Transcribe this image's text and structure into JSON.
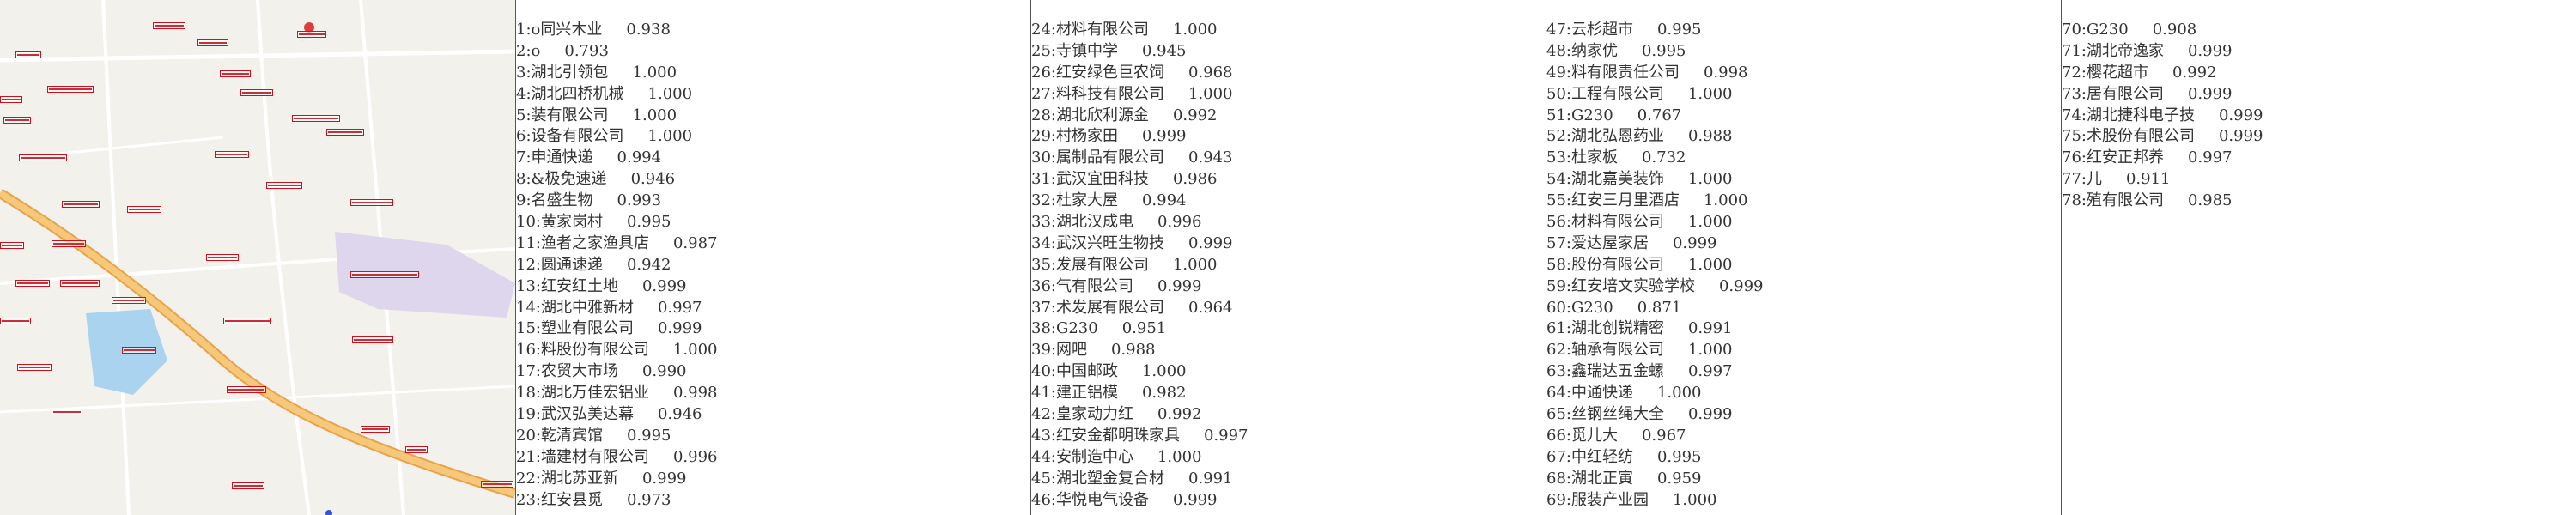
{
  "results": [
    {
      "n": "1:",
      "text": "o同兴木业",
      "score": "0.938"
    },
    {
      "n": "2:",
      "text": "o",
      "score": "0.793"
    },
    {
      "n": "3:",
      "text": "湖北引领包",
      "score": "1.000"
    },
    {
      "n": "4:",
      "text": "湖北四桥机械",
      "score": "1.000"
    },
    {
      "n": "5:",
      "text": "装有限公司",
      "score": "1.000"
    },
    {
      "n": "6:",
      "text": "设备有限公司",
      "score": "1.000"
    },
    {
      "n": "7:",
      "text": "申通快递",
      "score": "0.994"
    },
    {
      "n": "8:",
      "text": "&极免速递",
      "score": "0.946"
    },
    {
      "n": "9:",
      "text": "名盛生物",
      "score": "0.993"
    },
    {
      "n": "10:",
      "text": "黄家岗村",
      "score": "0.995"
    },
    {
      "n": "11:",
      "text": "渔者之家渔具店",
      "score": "0.987"
    },
    {
      "n": "12:",
      "text": "圆通速递",
      "score": "0.942"
    },
    {
      "n": "13:",
      "text": "红安红土地",
      "score": "0.999"
    },
    {
      "n": "14:",
      "text": "湖北中雅新材",
      "score": "0.997"
    },
    {
      "n": "15:",
      "text": "塑业有限公司",
      "score": "0.999"
    },
    {
      "n": "16:",
      "text": "料股份有限公司",
      "score": "1.000"
    },
    {
      "n": "17:",
      "text": "农贸大市场",
      "score": "0.990"
    },
    {
      "n": "18:",
      "text": "湖北万佳宏铝业",
      "score": "0.998"
    },
    {
      "n": "19:",
      "text": "武汉弘美达幕",
      "score": "0.946"
    },
    {
      "n": "20:",
      "text": "乾清宾馆",
      "score": "0.995"
    },
    {
      "n": "21:",
      "text": "墙建材有限公司",
      "score": "0.996"
    },
    {
      "n": "22:",
      "text": "湖北苏亚新",
      "score": "0.999"
    },
    {
      "n": "23:",
      "text": "红安县觅",
      "score": "0.973"
    },
    {
      "n": "24:",
      "text": "材料有限公司",
      "score": "1.000"
    },
    {
      "n": "25:",
      "text": "寺镇中学",
      "score": "0.945"
    },
    {
      "n": "26:",
      "text": "红安绿色巨农饲",
      "score": "0.968"
    },
    {
      "n": "27:",
      "text": "料科技有限公司",
      "score": "1.000"
    },
    {
      "n": "28:",
      "text": "湖北欣利源金",
      "score": "0.992"
    },
    {
      "n": "29:",
      "text": "村杨家田",
      "score": "0.999"
    },
    {
      "n": "30:",
      "text": "属制品有限公司",
      "score": "0.943"
    },
    {
      "n": "31:",
      "text": "武汉宜田科技",
      "score": "0.986"
    },
    {
      "n": "32:",
      "text": "杜家大屋",
      "score": "0.994"
    },
    {
      "n": "33:",
      "text": "湖北汉成电",
      "score": "0.996"
    },
    {
      "n": "34:",
      "text": "武汉兴旺生物技",
      "score": "0.999"
    },
    {
      "n": "35:",
      "text": "发展有限公司",
      "score": "1.000"
    },
    {
      "n": "36:",
      "text": "气有限公司",
      "score": "0.999"
    },
    {
      "n": "37:",
      "text": "术发展有限公司",
      "score": "0.964"
    },
    {
      "n": "38:",
      "text": "G230",
      "score": "0.951"
    },
    {
      "n": "39:",
      "text": "网吧",
      "score": "0.988"
    },
    {
      "n": "40:",
      "text": "中国邮政",
      "score": "1.000"
    },
    {
      "n": "41:",
      "text": "建正铝模",
      "score": "0.982"
    },
    {
      "n": "42:",
      "text": "皇家动力红",
      "score": "0.992"
    },
    {
      "n": "43:",
      "text": "红安金都明珠家具",
      "score": "0.997"
    },
    {
      "n": "44:",
      "text": "安制造中心",
      "score": "1.000"
    },
    {
      "n": "45:",
      "text": "湖北塑金复合材",
      "score": "0.991"
    },
    {
      "n": "46:",
      "text": "华悦电气设备",
      "score": "0.999"
    },
    {
      "n": "47:",
      "text": "云杉超市",
      "score": "0.995"
    },
    {
      "n": "48:",
      "text": "纳家优",
      "score": "0.995"
    },
    {
      "n": "49:",
      "text": "料有限责任公司",
      "score": "0.998"
    },
    {
      "n": "50:",
      "text": "工程有限公司",
      "score": "1.000"
    },
    {
      "n": "51:",
      "text": "G230",
      "score": "0.767"
    },
    {
      "n": "52:",
      "text": "湖北弘恩药业",
      "score": "0.988"
    },
    {
      "n": "53:",
      "text": "杜家板",
      "score": "0.732"
    },
    {
      "n": "54:",
      "text": "湖北嘉美装饰",
      "score": "1.000"
    },
    {
      "n": "55:",
      "text": "红安三月里酒店",
      "score": "1.000"
    },
    {
      "n": "56:",
      "text": "材料有限公司",
      "score": "1.000"
    },
    {
      "n": "57:",
      "text": "爱达屋家居",
      "score": "0.999"
    },
    {
      "n": "58:",
      "text": "股份有限公司",
      "score": "1.000"
    },
    {
      "n": "59:",
      "text": "红安培文实验学校",
      "score": "0.999"
    },
    {
      "n": "60:",
      "text": "G230",
      "score": "0.871"
    },
    {
      "n": "61:",
      "text": "湖北创锐精密",
      "score": "0.991"
    },
    {
      "n": "62:",
      "text": "轴承有限公司",
      "score": "1.000"
    },
    {
      "n": "63:",
      "text": "鑫瑞达五金螺",
      "score": "0.997"
    },
    {
      "n": "64:",
      "text": "中通快递",
      "score": "1.000"
    },
    {
      "n": "65:",
      "text": "丝钢丝绳大全",
      "score": "0.999"
    },
    {
      "n": "66:",
      "text": "觅儿大",
      "score": "0.967"
    },
    {
      "n": "67:",
      "text": "中红轻纺",
      "score": "0.995"
    },
    {
      "n": "68:",
      "text": "湖北正寅",
      "score": "0.959"
    },
    {
      "n": "69:",
      "text": "服装产业园",
      "score": "1.000"
    },
    {
      "n": "70:",
      "text": "G230",
      "score": "0.908"
    },
    {
      "n": "71:",
      "text": "湖北帝逸家",
      "score": "0.999"
    },
    {
      "n": "72:",
      "text": "樱花超市",
      "score": "0.992"
    },
    {
      "n": "73:",
      "text": "居有限公司",
      "score": "0.999"
    },
    {
      "n": "74:",
      "text": "湖北捷科电子技",
      "score": "0.999"
    },
    {
      "n": "75:",
      "text": "术股份有限公司",
      "score": "0.999"
    },
    {
      "n": "76:",
      "text": "红安正邦养",
      "score": "0.997"
    },
    {
      "n": "77:",
      "text": "儿",
      "score": "0.911"
    },
    {
      "n": "78:",
      "text": "殖有限公司",
      "score": "0.985"
    }
  ],
  "colors": {
    "detection_box": "#d0101c",
    "road_main": "#f1b55e",
    "water": "#a9d3ee",
    "zone": "#ddd6ec"
  }
}
